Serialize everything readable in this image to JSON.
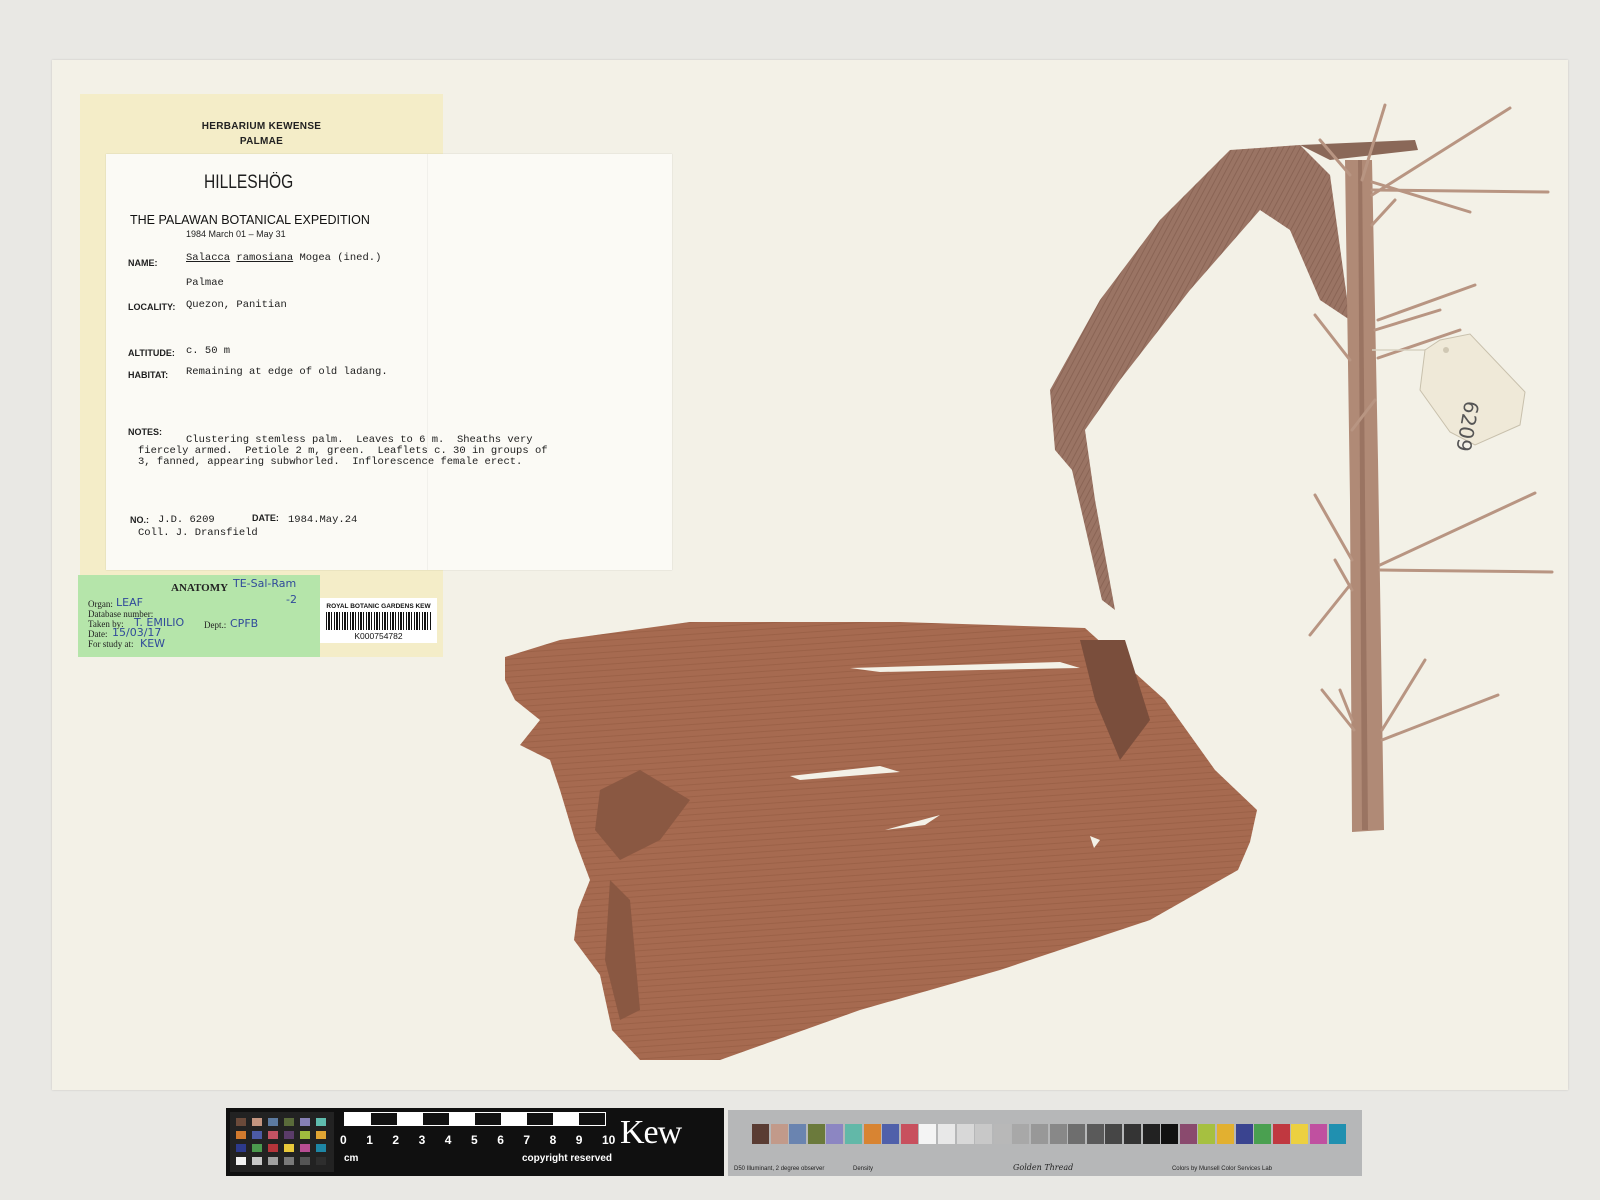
{
  "herbarium": {
    "line1": "HERBARIUM KEWENSE",
    "line2": "PALMAE"
  },
  "label": {
    "collector_logo": "HILLESHÖG",
    "expedition": "THE PALAWAN BOTANICAL EXPEDITION",
    "expedition_dates_year": "1984",
    "expedition_dates": "March 01 – May 31",
    "name_label": "NAME:",
    "name_genus": "Salacca",
    "name_species": "ramosiana",
    "name_author": "Mogea (ined.)",
    "family": "Palmae",
    "locality_label": "LOCALITY:",
    "locality": "Quezon, Panitian",
    "altitude_label": "ALTITUDE:",
    "altitude": "c. 50 m",
    "habitat_label": "HABITAT:",
    "habitat": "Remaining at edge of old ladang.",
    "notes_label": "NOTES:",
    "notes_line1": "Clustering stemless palm.  Leaves to 6 m.  Sheaths very",
    "notes_line2": "fiercely armed.  Petiole 2 m, green.  Leaflets c. 30 in groups of",
    "notes_line3": "3, fanned, appearing subwhorled.  Inflorescence female erect.",
    "no_label": "NO.:",
    "number": "J.D. 6209",
    "date_label": "DATE:",
    "date": "1984.May.24",
    "coll": "Coll.  J. Dransfield"
  },
  "anatomy": {
    "title": "ANATOMY",
    "code_hand": "TE-Sal-Ram",
    "code_hand2": "-2",
    "organ_label": "Organ:",
    "organ": "LEAF",
    "db_label": "Database number:",
    "taken_label": "Taken by:",
    "taken": "T. EMILIO",
    "dept_label": "Dept.:",
    "dept": "CPFB",
    "date_label": "Date:",
    "date": "15/03/17",
    "study_label": "For study at:",
    "study": "KEW"
  },
  "barcode": {
    "institution": "ROYAL BOTANIC GARDENS KEW",
    "number": "K000754782"
  },
  "specimen_tag": {
    "number": "6209"
  },
  "scale": {
    "numbers": [
      "0",
      "1",
      "2",
      "3",
      "4",
      "5",
      "6",
      "7",
      "8",
      "9",
      "10"
    ],
    "unit": "cm",
    "copyright": "copyright reserved",
    "brand": "Kew",
    "card_note": "D50 Illuminant, 2 degree observer",
    "density": "Density",
    "golden": "Golden Thread",
    "colors_note": "Colors by Munsell Color Services Lab",
    "checker_colors": [
      "#6b4a3a",
      "#c49580",
      "#5c7aa0",
      "#5a6b3a",
      "#8680b5",
      "#5fbcae",
      "#d27a2e",
      "#4c5aa5",
      "#c25263",
      "#5b3c6a",
      "#9fbc3e",
      "#e0a533",
      "#2d3a8c",
      "#4b9a4e",
      "#b5343a",
      "#e8c83a",
      "#b84d93",
      "#1e86a5",
      "#f2f2f2",
      "#c8c8c8",
      "#a0a0a0",
      "#7a7a7a",
      "#555555",
      "#2e2e2e"
    ],
    "gray_card_colors": [
      "#5a3c33",
      "#c29a8a",
      "#6a84b0",
      "#6b7a3c",
      "#8c86c2",
      "#62b8a8",
      "#d88432",
      "#5060aa",
      "#c8505e",
      "#f4f4f4",
      "#e8e8e8",
      "#d8d8d8",
      "#c8c8c8",
      "#b8b8b8",
      "#a8a8a8",
      "#989898",
      "#888888",
      "#6e6e6e",
      "#5a5a5a",
      "#464646",
      "#343434",
      "#222222",
      "#111111",
      "#8a4a6e",
      "#a6c040",
      "#e2b030",
      "#3a4490",
      "#4aa050",
      "#c03840",
      "#ecd040",
      "#c050a0",
      "#2090b0"
    ]
  }
}
